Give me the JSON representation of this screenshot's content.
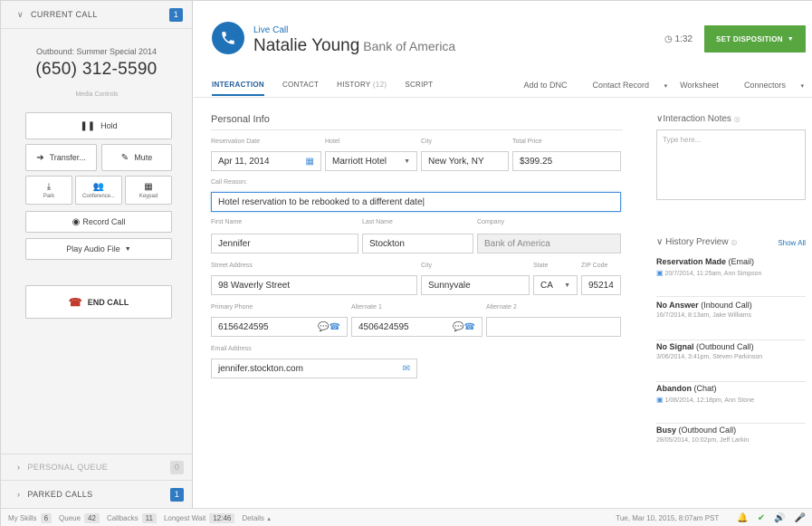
{
  "left": {
    "current_call_label": "CURRENT CALL",
    "current_call_count": "1",
    "outbound_prefix": "Outbound:",
    "campaign": "Summer Special 2014",
    "number": "(650) 312-5590",
    "media_controls": "Media Controls",
    "hold": "Hold",
    "transfer": "Transfer...",
    "mute": "Mute",
    "park": "Park",
    "conference": "Conference...",
    "keypad": "Keypad",
    "record": "Record Call",
    "play_audio": "Play Audio File",
    "end_call": "END CALL",
    "personal_queue": "PERSONAL QUEUE",
    "personal_queue_count": "0",
    "parked_calls": "PARKED CALLS",
    "parked_calls_count": "1"
  },
  "header": {
    "live_call": "Live Call",
    "name": "Natalie Young",
    "company": "Bank of America",
    "timer": "1:32",
    "disposition": "SET DISPOSITION"
  },
  "tabs": [
    {
      "label": "INTERACTION"
    },
    {
      "label": "CONTACT"
    },
    {
      "label": "HISTORY",
      "count": "(12)"
    },
    {
      "label": "SCRIPT"
    }
  ],
  "tab_actions": [
    "Add to DNC",
    "Contact Record",
    "Worksheet",
    "Connectors"
  ],
  "form": {
    "title": "Personal Info",
    "reservation_date_label": "Reservation Date",
    "reservation_date": "Apr 11, 2014",
    "hotel_label": "Hotel",
    "hotel": "Marriott Hotel",
    "city_label": "City",
    "city": "New York, NY",
    "total_price_label": "Total Price",
    "total_price": "$399.25",
    "call_reason_label": "Call Reason:",
    "call_reason": "Hotel reservation to be rebooked to a different date",
    "first_name_label": "First Name",
    "first_name": "Jennifer",
    "last_name_label": "Last Name",
    "last_name": "Stockton",
    "company_label": "Company",
    "company": "Bank of America",
    "street_label": "Street Address",
    "street": "98 Waverly Street",
    "city2_label": "City",
    "city2": "Sunnyvale",
    "state_label": "State",
    "state": "CA",
    "zip_label": "ZIP Code",
    "zip": "95214",
    "primary_phone_label": "Primary Phone",
    "primary_phone": "6156424595",
    "alt1_label": "Alternate 1",
    "alt1": "4506424595",
    "alt2_label": "Alternate 2",
    "alt2": "",
    "email_label": "Email Address",
    "email": "jennifer.stockton.com"
  },
  "notes": {
    "title": "Interaction Notes",
    "placeholder": "Type here..."
  },
  "history": {
    "title": "History Preview",
    "show_all": "Show All",
    "items": [
      {
        "title": "Reservation Made",
        "type": "(Email)",
        "meta": "20/7/2014, 11:25am, Ann Simpson",
        "doc": true
      },
      {
        "title": "No Answer",
        "type": "(Inbound Call)",
        "meta": "16/7/2014, 8:13am, Jake Williams",
        "doc": false
      },
      {
        "title": "No Signal",
        "type": "(Outbound Call)",
        "meta": "3/06/2014, 3:41pm, Steven Parkinson",
        "doc": false
      },
      {
        "title": "Abandon",
        "type": "(Chat)",
        "meta": "1/06/2014, 12:18pm, Ann Stone",
        "doc": true
      },
      {
        "title": "Busy",
        "type": "(Outbound Call)",
        "meta": "28/05/2014, 10:02pm, Jeff Larkin",
        "doc": false
      }
    ]
  },
  "status": {
    "my_skills": "My Skills",
    "my_skills_count": "6",
    "queue": "Queue",
    "queue_count": "42",
    "callbacks": "Callbacks",
    "callbacks_count": "11",
    "longest_wait": "Longest Wait",
    "longest_wait_value": "12:46",
    "details": "Details",
    "datetime": "Tue, Mar 10, 2015, 8:07am PST"
  },
  "colors": {
    "accent": "#1f72b8",
    "disposition": "#57a640",
    "end_call": "#c0392b"
  }
}
